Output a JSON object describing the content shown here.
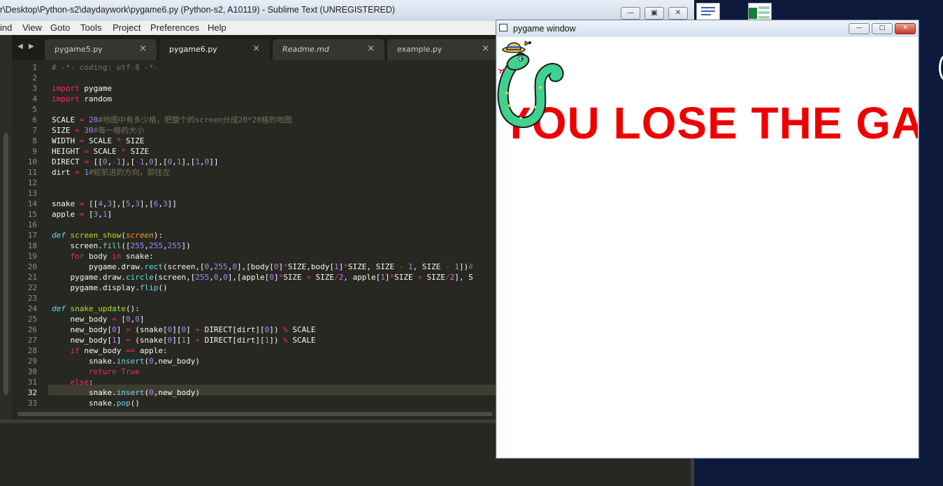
{
  "sublime": {
    "title": "r\\Desktop\\Python-s2\\daydaywork\\pygame6.py (Python-s2, A10119) - Sublime Text (UNREGISTERED)",
    "menu": [
      "ind",
      "View",
      "Goto",
      "Tools",
      "Project",
      "Preferences",
      "Help"
    ],
    "tabs": [
      {
        "label": "pygame5.py",
        "active": false,
        "italic": false
      },
      {
        "label": "pygame6.py",
        "active": true,
        "italic": false
      },
      {
        "label": "Readme.md",
        "active": false,
        "italic": true
      },
      {
        "label": "example.py",
        "active": false,
        "italic": false
      }
    ],
    "current_line": 32,
    "line_numbers": [
      "1",
      "2",
      "3",
      "4",
      "5",
      "6",
      "7",
      "8",
      "9",
      "10",
      "11",
      "12",
      "13",
      "14",
      "15",
      "16",
      "17",
      "18",
      "19",
      "20",
      "21",
      "22",
      "23",
      "24",
      "25",
      "26",
      "27",
      "28",
      "29",
      "30",
      "31",
      "32",
      "33"
    ],
    "code_lines": [
      "# -*- coding: utf-8 -*-",
      "",
      "import pygame",
      "import random",
      "",
      "SCALE = 20#地图中有多少格，把整个的screen分成20*20格的地图",
      "SIZE = 30#每一格的大小",
      "WIDTH = SCALE * SIZE",
      "HEIGHT = SCALE * SIZE",
      "DIRECT = [[0,-1],[-1,0],[0,1],[1,0]]",
      "dirt = 1#蛇前进的方向，即往左",
      "",
      "",
      "snake = [[4,3],[5,3],[6,3]]",
      "apple = [3,1]",
      "",
      "def screen_show(screen):",
      "    screen.fill([255,255,255])",
      "    for body in snake:",
      "        pygame.draw.rect(screen,[0,255,0],[body[0]*SIZE,body[1]*SIZE, SIZE - 1, SIZE - 1])#",
      "    pygame.draw.circle(screen,[255,0,0],[apple[0]*SIZE + SIZE/2, apple[1]*SIZE + SIZE/2], S",
      "    pygame.display.flip()",
      "",
      "def snake_update():",
      "    new_body = [0,0]",
      "    new_body[0] = (snake[0][0] + DIRECT[dirt][0]) % SCALE",
      "    new_body[1] = (snake[0][1] + DIRECT[dirt][1]) % SCALE",
      "    if new_body == apple:",
      "        snake.insert(0,new_body)",
      "        return True",
      "    else:",
      "        snake.insert(0,new_body)",
      "        snake.pop()"
    ]
  },
  "pygame_window": {
    "title": "pygame window",
    "message": "YOU LOSE THE GA"
  },
  "icons": {
    "tab_close": "close-icon",
    "nav_left": "arrow-left-icon",
    "nav_right": "arrow-right-icon",
    "minimize": "minimize-icon",
    "maximize": "maximize-icon",
    "close": "close-icon"
  },
  "colors": {
    "editor_bg": "#272822",
    "message_red": "#ee0000",
    "desktop_bg": "#0e1a3b"
  }
}
